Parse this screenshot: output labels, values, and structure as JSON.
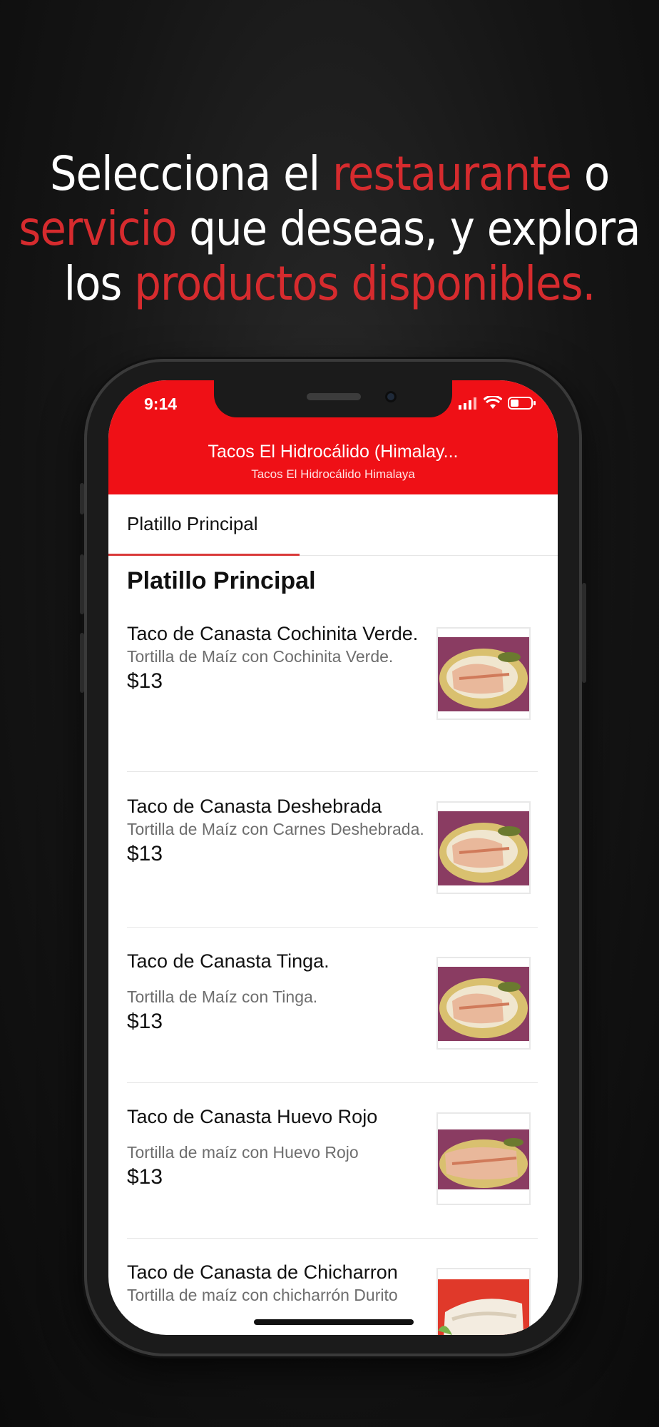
{
  "promo": {
    "line1_a": "Selecciona el ",
    "line1_hl": "restaurante",
    "line1_b": " o",
    "line2_hl": "servicio",
    "line2_b": " que deseas, y explora",
    "line3_a": "los ",
    "line3_hl": "productos disponibles."
  },
  "colors": {
    "accent": "#ef1016",
    "highlight": "#d62b2e"
  },
  "status": {
    "time": "9:14"
  },
  "header": {
    "title": "Tacos El Hidrocálido (Himalay...",
    "subtitle": "Tacos El Hidrocálido Himalaya"
  },
  "tabs": [
    {
      "label": "Platillo Principal",
      "active": true
    }
  ],
  "section": {
    "title": "Platillo Principal"
  },
  "items": [
    {
      "name": "Taco de Canasta Cochinita Verde.",
      "description": "Tortilla de Maíz con Cochinita Verde.",
      "price": "$13"
    },
    {
      "name": "Taco de Canasta Deshebrada",
      "description": "Tortilla de Maíz con Carnes Deshebrada.",
      "price": "$13"
    },
    {
      "name": "Taco de Canasta Tinga.",
      "description": "Tortilla de Maíz con Tinga.",
      "price": "$13"
    },
    {
      "name": "Taco de Canasta Huevo Rojo",
      "description": "Tortilla de maíz con Huevo Rojo",
      "price": "$13"
    },
    {
      "name": "Taco de Canasta de Chicharron",
      "description": "Tortilla de maíz con chicharrón Durito",
      "price": ""
    }
  ]
}
